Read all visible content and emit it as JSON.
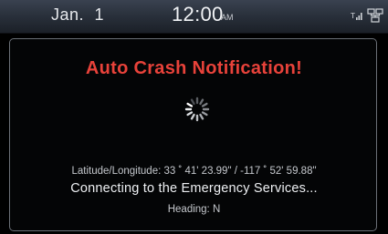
{
  "status_bar": {
    "date": "Jan.  1",
    "time": "12:00",
    "ampm": "AM",
    "icons": [
      "signal-icon",
      "network-icon"
    ]
  },
  "popup": {
    "title": "Auto Crash Notification!",
    "spinner_icon": "spinner-icon",
    "location_line": "Latitude/Longitude: 33 ˚ 41' 23.99\" / -117 ˚ 52' 59.88\"",
    "heading_line": "Heading: N",
    "status_text": "Connecting to the Emergency Services..."
  },
  "colors": {
    "title_red": "#e8423a",
    "status_bar_top": "#3a4250",
    "border_gray": "#6a6f76"
  }
}
